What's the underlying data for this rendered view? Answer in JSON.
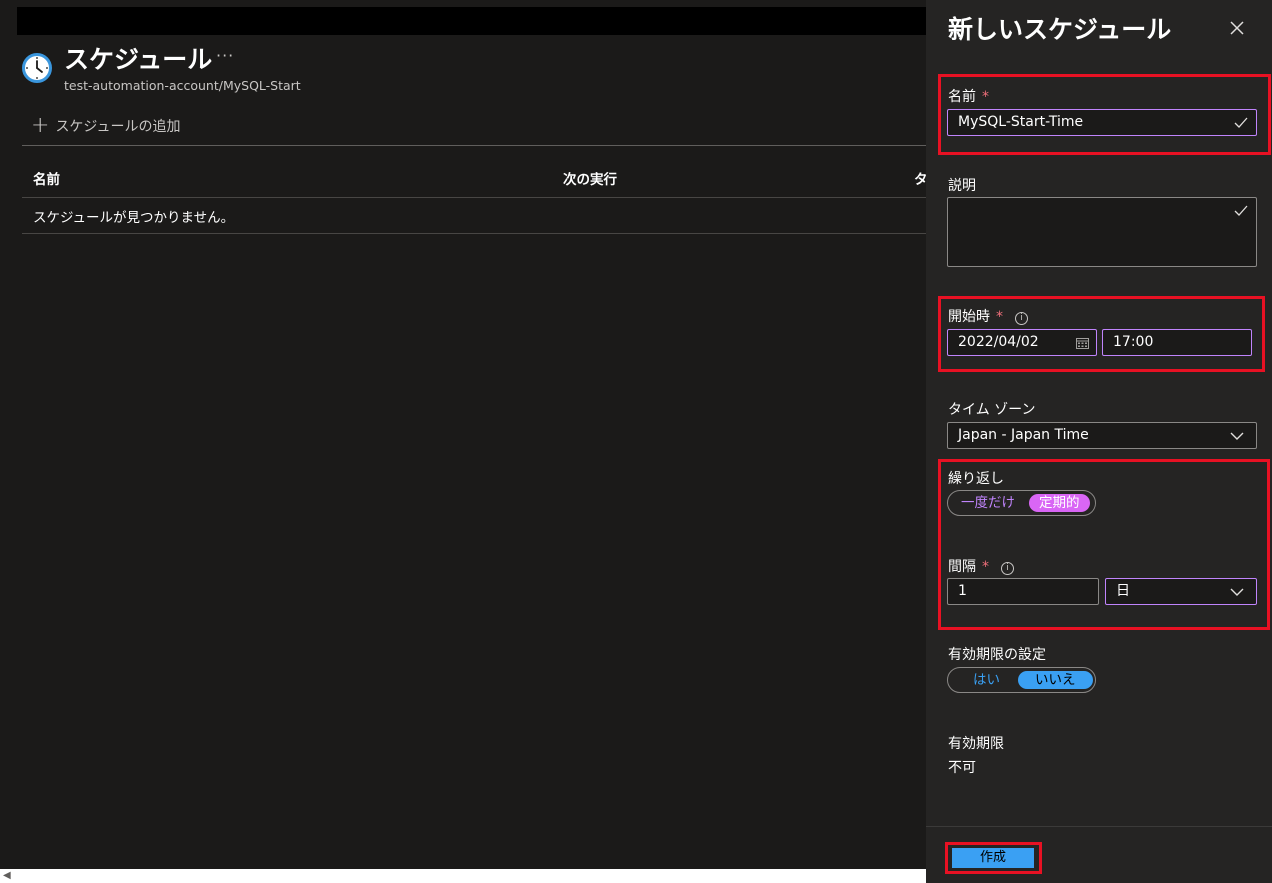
{
  "page": {
    "title": "スケジュール",
    "more_label": "···",
    "subtitle": "test-automation-account/MySQL-Start",
    "add_schedule_label": "スケジュールの追加",
    "columns": [
      "名前",
      "次の実行",
      "タ"
    ],
    "empty_message": "スケジュールが見つかりません。"
  },
  "panel": {
    "title": "新しいスケジュール",
    "name": {
      "label": "名前",
      "required_mark": "*",
      "value": "MySQL-Start-Time"
    },
    "description": {
      "label": "説明",
      "value": ""
    },
    "start": {
      "label": "開始時",
      "required_mark": "*",
      "info_icon": "ⓘ",
      "date": "2022/04/02",
      "time": "17:00"
    },
    "timezone": {
      "label": "タイム ゾーン",
      "value": "Japan - Japan Time"
    },
    "recurrence": {
      "label": "繰り返し",
      "options": [
        "一度だけ",
        "定期的"
      ],
      "selected": "定期的"
    },
    "interval": {
      "label": "間隔",
      "required_mark": "*",
      "info_icon": "ⓘ",
      "value": "1",
      "unit": "日"
    },
    "expiration_setting": {
      "label": "有効期限の設定",
      "options": [
        "はい",
        "いいえ"
      ],
      "selected": "いいえ"
    },
    "expiration": {
      "label": "有効期限",
      "value": "不可"
    },
    "create_label": "作成"
  },
  "colors": {
    "accent_purple": "#c084fc",
    "toggle_purple_bg": "#d966f5",
    "accent_blue": "#3aa0f3",
    "highlight_red": "#e81123"
  },
  "icons": [
    "clock-icon",
    "more-icon",
    "plus-icon",
    "close-icon",
    "checkmark-icon",
    "calendar-icon",
    "info-icon",
    "chevron-down-icon"
  ]
}
